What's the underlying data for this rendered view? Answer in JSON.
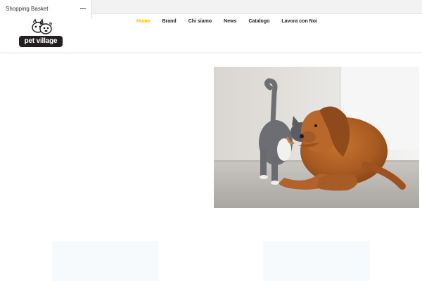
{
  "basket": {
    "label": "Shopping Basket"
  },
  "logo": {
    "text": "pet village"
  },
  "nav": [
    {
      "label": "Home",
      "active": true
    },
    {
      "label": "Brand",
      "active": false
    },
    {
      "label": "Chi siamo",
      "active": false
    },
    {
      "label": "News",
      "active": false
    },
    {
      "label": "Catalogo",
      "active": false
    },
    {
      "label": "Lavora con Noi",
      "active": false
    }
  ],
  "colors": {
    "accent": "#f2c200",
    "nav_text": "#222222",
    "logo_plate": "#231f20"
  }
}
